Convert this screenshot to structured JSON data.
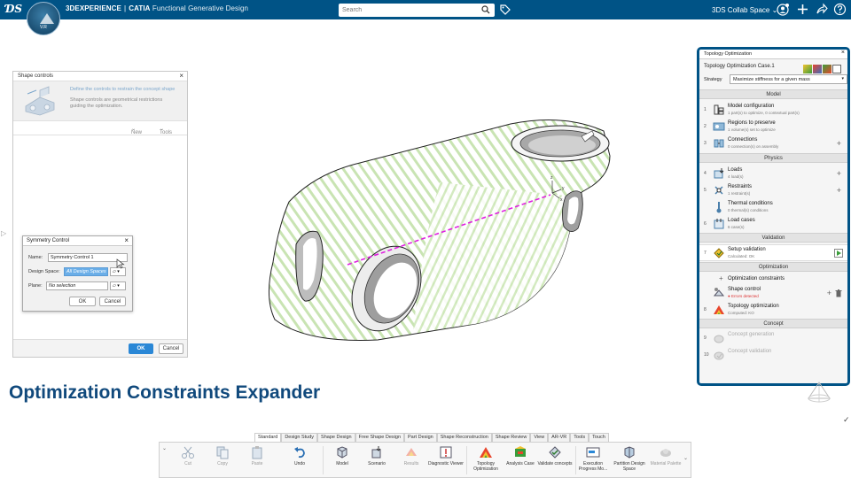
{
  "topbar": {
    "brand": "3DEXPERIENCE",
    "app": "CATIA",
    "module": "Functional Generative Design",
    "version": "V.R",
    "search_placeholder": "Search",
    "collab_space": "3DS Collab Space"
  },
  "shape_controls": {
    "title": "Shape controls",
    "intro_title": "Define the controls to restrain the concept shape",
    "intro_text": "Shape controls are geometrical restrictions guiding the optimization.",
    "menu_new": "New",
    "menu_tools": "Tools",
    "ok": "OK",
    "cancel": "Cancel"
  },
  "symmetry": {
    "title": "Symmetry Control",
    "name_label": "Name:",
    "name_value": "Symmetry Control 1",
    "design_space_label": "Design Space:",
    "design_space_value": "All Design Spaces",
    "plane_label": "Plane:",
    "plane_value": "No selection",
    "ok": "OK",
    "cancel": "Cancel"
  },
  "topology": {
    "tab": "Topology Optimization",
    "case": "Topology Optimization Case.1",
    "strategy_label": "Strategy",
    "strategy_value": "Maximize stiffness for a given mass",
    "sections": {
      "model": "Model",
      "physics": "Physics",
      "validation": "Validation",
      "optimization": "Optimization",
      "concept": "Concept"
    },
    "rows": [
      {
        "num": "1",
        "title": "Model configuration",
        "sub": "1 part(s) to optimize, 0 contextual part(s)"
      },
      {
        "num": "2",
        "title": "Regions to preserve",
        "sub": "1 volume(s) set to optimize"
      },
      {
        "num": "3",
        "title": "Connections",
        "sub": "0 connection(s) on assembly"
      },
      {
        "num": "4",
        "title": "Loads",
        "sub": "4 load(s)"
      },
      {
        "num": "5",
        "title": "Restraints",
        "sub": "1 restraint(s)"
      },
      {
        "num": "",
        "title": "Thermal conditions",
        "sub": "0 thermal(s) conditions"
      },
      {
        "num": "6",
        "title": "Load cases",
        "sub": "6 case(s)"
      },
      {
        "num": "7",
        "title": "Setup validation",
        "sub": "Calculated: OK"
      },
      {
        "num": "",
        "title": "Optimization constraints",
        "sub": ""
      },
      {
        "num": "",
        "title": "Shape control",
        "sub": "Errors detected"
      },
      {
        "num": "8",
        "title": "Topology optimization",
        "sub": "Computed: KO"
      },
      {
        "num": "9",
        "title": "Concept generation",
        "sub": ""
      },
      {
        "num": "10",
        "title": "Concept validation",
        "sub": ""
      }
    ]
  },
  "heading": "Optimization Constraints Expander",
  "tabs": [
    "Standard",
    "Design Study",
    "Shape Design",
    "Free Shape Design",
    "Part Design",
    "Shape Reconstruction",
    "Shape Review",
    "View",
    "AR-VR",
    "Tools",
    "Touch"
  ],
  "tools": [
    {
      "label": "Cut",
      "icon": "scissors-icon",
      "dim": true
    },
    {
      "label": "Copy",
      "icon": "copy-icon",
      "dim": true
    },
    {
      "label": "Paste",
      "icon": "paste-icon",
      "dim": true
    },
    {
      "label": "Undo",
      "icon": "undo-icon",
      "dim": false
    },
    {
      "label": "Model",
      "icon": "model-icon",
      "dim": false
    },
    {
      "label": "Scenario",
      "icon": "scenario-icon",
      "dim": false
    },
    {
      "label": "Results",
      "icon": "results-icon",
      "dim": true
    },
    {
      "label": "Diagnostic Viewer",
      "icon": "diagnostic-icon",
      "dim": false
    },
    {
      "label": "Topology Optimization",
      "icon": "topology-icon",
      "dim": false
    },
    {
      "label": "Analysis Case",
      "icon": "analysis-case-icon",
      "dim": false
    },
    {
      "label": "Validate concepts",
      "icon": "validate-icon",
      "dim": false
    },
    {
      "label": "Execution Progress Mo...",
      "icon": "progress-icon",
      "dim": false
    },
    {
      "label": "Partition Design Space",
      "icon": "partition-icon",
      "dim": false
    },
    {
      "label": "Material Palette",
      "icon": "material-icon",
      "dim": true
    }
  ],
  "colors": {
    "topbar": "#005386",
    "heading": "#10497c",
    "symmetry_line": "#e020e0",
    "pattern_green": "#b9dba0"
  }
}
